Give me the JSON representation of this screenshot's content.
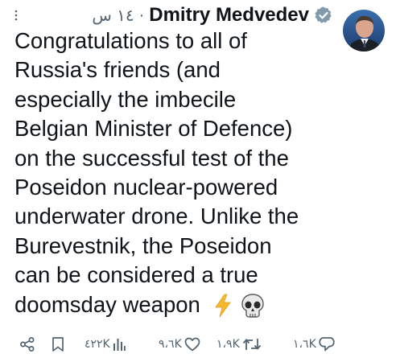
{
  "tweet": {
    "author_name": "Dmitry Medvedev",
    "separator": "·",
    "timestamp": "١٤ س",
    "verified": true,
    "accent_color": "#536471",
    "body_lines": [
      "Congratulations to all of",
      "Russia's friends (and",
      "especially the imbecile",
      "Belgian Minister of Defence)",
      "on the successful test of the",
      "Poseidon nuclear-powered",
      "underwater drone. Unlike the",
      "Burevestnik, the Poseidon",
      "can be considered a true",
      "doomsday weapon"
    ],
    "emojis": [
      "lightning-emoji",
      "skull-emoji"
    ]
  },
  "actions": {
    "replies": "١،٦K",
    "reposts": "١،٩K",
    "likes": "٩،٦K",
    "views": "٤٢٢K"
  },
  "icons": {
    "more": "more-dots-icon",
    "share": "share-icon",
    "bookmark": "bookmark-icon",
    "views": "views-bar-chart-icon",
    "like": "heart-icon",
    "repost": "repost-icon",
    "reply": "reply-bubble-icon"
  }
}
